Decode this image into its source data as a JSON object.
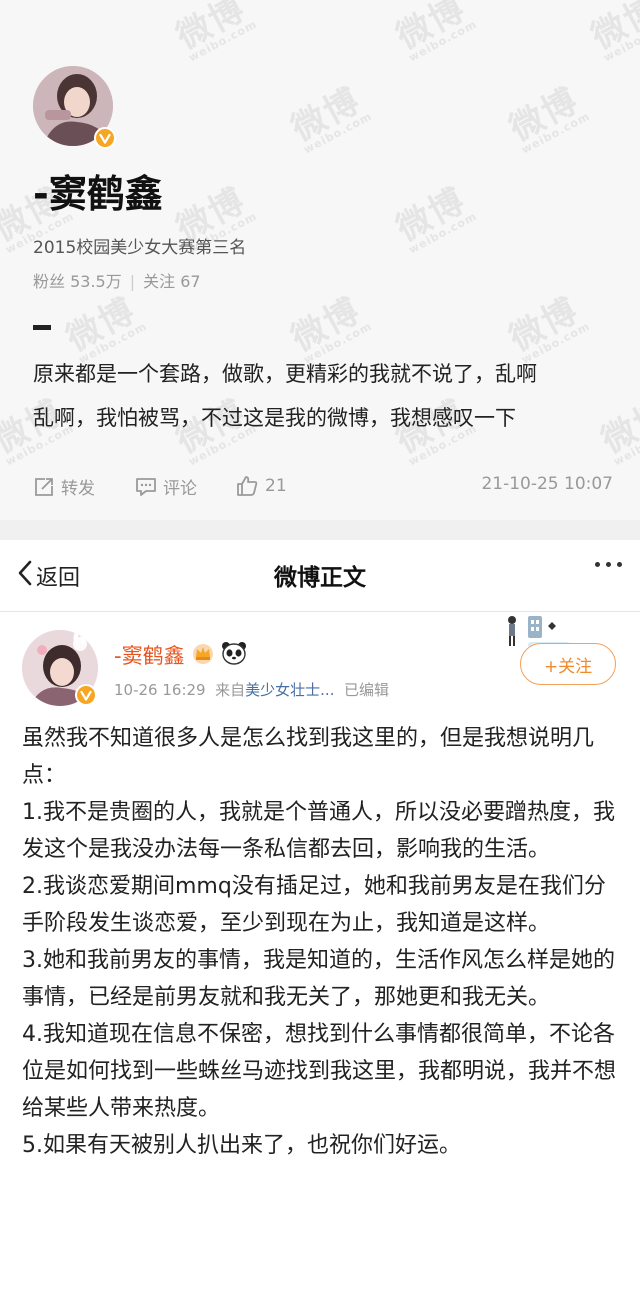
{
  "watermark": {
    "text": "微博",
    "sub": "weibo.com"
  },
  "top_post": {
    "name": "-窦鹤鑫",
    "bio": "2015校园美少女大赛第三名",
    "stats": {
      "fans_label": "粉丝",
      "fans_value": "53.5万",
      "follow_label": "关注",
      "follow_value": "67"
    },
    "content_lines": [
      "原来都是一个套路，做歌，更精彩的我就不说了，乱啊",
      "乱啊，我怕被骂，不过这是我的微博，我想感叹一下"
    ],
    "actions": {
      "repost": "转发",
      "comment": "评论",
      "like_count": "21"
    },
    "time": "21-10-25 10:07"
  },
  "nav": {
    "back_label": "返回",
    "title": "微博正文"
  },
  "post": {
    "name": "-窦鹤鑫",
    "time": "10-26 16:29",
    "from_prefix": "来自",
    "source": "美少女壮士...",
    "edited": "已编辑",
    "follow_label": "+关注",
    "paragraphs": [
      "虽然我不知道很多人是怎么找到我这里的，但是我想说明几点：",
      "1.我不是贵圈的人，我就是个普通人，所以没必要蹭热度，我发这个是我没办法每一条私信都去回，影响我的生活。",
      "2.我谈恋爱期间mmq没有插足过，她和我前男友是在我们分手阶段发生谈恋爱，至少到现在为止，我知道是这样。",
      "3.她和我前男友的事情，我是知道的，生活作风怎么样是她的事情，已经是前男友就和我无关了，那她更和我无关。",
      "4.我知道现在信息不保密，想找到什么事情都很简单，不论各位是如何找到一些蛛丝马迹找到我这里，我都明说，我并不想给某些人带来热度。",
      "5.如果有天被别人扒出来了，也祝你们好运。"
    ]
  },
  "colors": {
    "accent": "#e8541e",
    "badge": "#f6a623",
    "follow": "#f08a2c",
    "source_link": "#4a6fa5"
  },
  "icons": [
    "repost-icon",
    "comment-icon",
    "like-icon",
    "back-chevron-icon",
    "more-icon",
    "verified-icon",
    "crown-icon",
    "panda-icon"
  ]
}
